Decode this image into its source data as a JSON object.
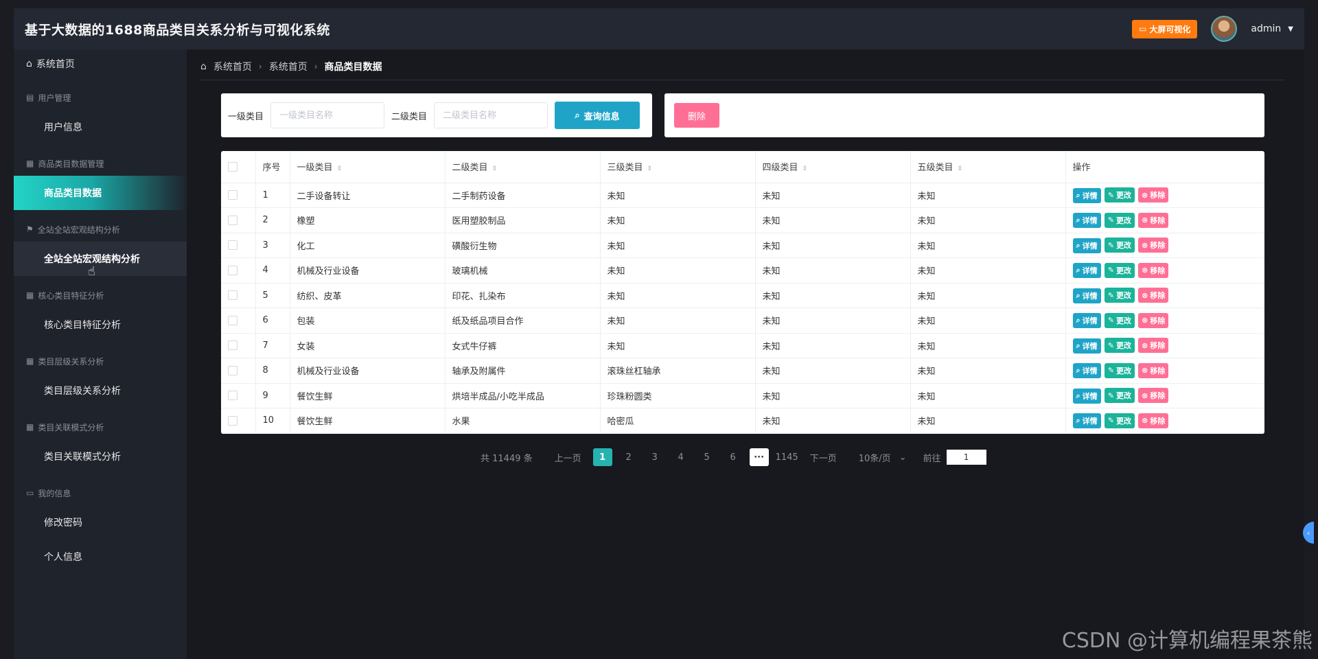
{
  "app": {
    "title": "基于大数据的1688商品类目关系分析与可视化系统",
    "bigscreen_label": "大屏可视化",
    "user": "admin"
  },
  "sidebar": {
    "home": "系统首页",
    "groups": [
      {
        "title": "用户管理",
        "items": [
          "用户信息"
        ]
      },
      {
        "title": "商品类目数据管理",
        "items": [
          "商品类目数据"
        ]
      },
      {
        "title": "全站全站宏观结构分析",
        "items": [
          "全站全站宏观结构分析"
        ]
      },
      {
        "title": "核心类目特征分析",
        "items": [
          "核心类目特征分析"
        ]
      },
      {
        "title": "类目层级关系分析",
        "items": [
          "类目层级关系分析"
        ]
      },
      {
        "title": "类目关联模式分析",
        "items": [
          "类目关联模式分析"
        ]
      },
      {
        "title": "我的信息",
        "items": [
          "修改密码",
          "个人信息"
        ]
      }
    ]
  },
  "breadcrumb": [
    "系统首页",
    "系统首页",
    "商品类目数据"
  ],
  "search": {
    "level1_label": "一级类目",
    "level1_placeholder": "一级类目名称",
    "level2_label": "二级类目",
    "level2_placeholder": "二级类目名称",
    "query_label": "查询信息",
    "delete_label": "删除"
  },
  "table": {
    "headers": [
      "序号",
      "一级类目",
      "二级类目",
      "三级类目",
      "四级类目",
      "五级类目",
      "操作"
    ],
    "actions": [
      "详情",
      "更改",
      "移除"
    ],
    "rows": [
      [
        "1",
        "二手设备转让",
        "二手制药设备",
        "未知",
        "未知",
        "未知"
      ],
      [
        "2",
        "橡塑",
        "医用塑胶制品",
        "未知",
        "未知",
        "未知"
      ],
      [
        "3",
        "化工",
        "磺酸衍生物",
        "未知",
        "未知",
        "未知"
      ],
      [
        "4",
        "机械及行业设备",
        "玻璃机械",
        "未知",
        "未知",
        "未知"
      ],
      [
        "5",
        "纺织、皮革",
        "印花、扎染布",
        "未知",
        "未知",
        "未知"
      ],
      [
        "6",
        "包装",
        "纸及纸品项目合作",
        "未知",
        "未知",
        "未知"
      ],
      [
        "7",
        "女装",
        "女式牛仔裤",
        "未知",
        "未知",
        "未知"
      ],
      [
        "8",
        "机械及行业设备",
        "轴承及附属件",
        "滚珠丝杠轴承",
        "未知",
        "未知"
      ],
      [
        "9",
        "餐饮生鲜",
        "烘培半成品/小吃半成品",
        "珍珠粉圆类",
        "未知",
        "未知"
      ],
      [
        "10",
        "餐饮生鲜",
        "水果",
        "哈密瓜",
        "未知",
        "未知"
      ]
    ]
  },
  "pagination": {
    "total": "共 11449 条",
    "prev": "上一页",
    "pages": [
      "1",
      "2",
      "3",
      "4",
      "5",
      "6"
    ],
    "more": "···",
    "last": "1145",
    "next": "下一页",
    "page_size": "10条/页",
    "goto_label": "前往",
    "goto_value": "1"
  },
  "watermark": "CSDN @计算机编程果茶熊"
}
